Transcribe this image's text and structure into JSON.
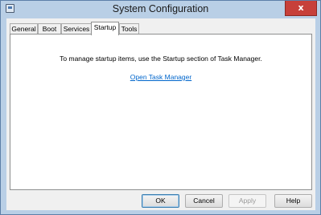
{
  "window": {
    "title": "System Configuration",
    "close_label": "x"
  },
  "tabs": [
    {
      "label": "General"
    },
    {
      "label": "Boot"
    },
    {
      "label": "Services"
    },
    {
      "label": "Startup"
    },
    {
      "label": "Tools"
    }
  ],
  "active_tab": "Startup",
  "startup": {
    "message": "To manage startup items, use the Startup section of Task Manager.",
    "link": "Open Task Manager"
  },
  "buttons": {
    "ok": "OK",
    "cancel": "Cancel",
    "apply": "Apply",
    "help": "Help"
  },
  "icons": {
    "app": "system-configuration-icon",
    "close": "close-icon"
  },
  "colors": {
    "titlebar": "#b9cfe6",
    "close": "#c7403a",
    "link": "#0066cc"
  }
}
